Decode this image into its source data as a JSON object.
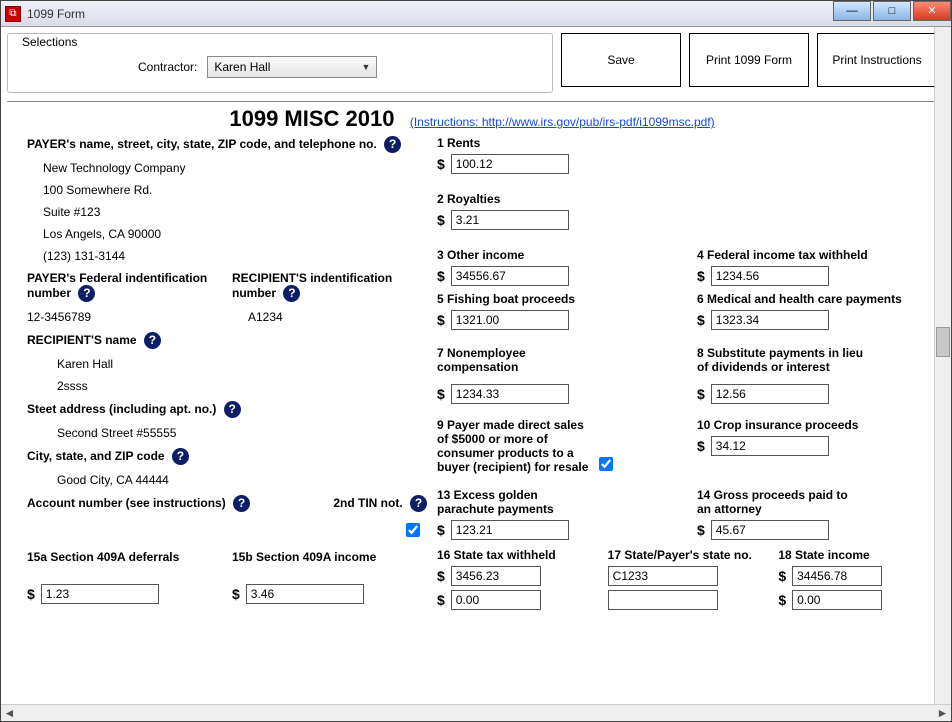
{
  "window": {
    "title": "1099 Form",
    "faded": "  "
  },
  "selections": {
    "legend": "Selections",
    "contractor_label": "Contractor:",
    "contractor_value": "Karen Hall"
  },
  "buttons": {
    "save": "Save",
    "print_form": "Print 1099 Form",
    "print_instr": "Print Instructions"
  },
  "form": {
    "title": "1099 MISC 2010",
    "instructions_link": "(Instructions: http://www.irs.gov/pub/irs-pdf/i1099msc.pdf)"
  },
  "payer": {
    "heading": "PAYER's name, street, city, state, ZIP code, and telephone no.",
    "name": "New Technology Company",
    "addr1": "100 Somewhere Rd.",
    "addr2": "Suite #123",
    "citystate": "Los Angels, CA 90000",
    "phone": "(123) 131-3144"
  },
  "payer_fed": {
    "label": "PAYER's Federal indentification number",
    "value": "12-3456789"
  },
  "recip_id": {
    "label": "RECIPIENT'S indentification number",
    "value": "A1234"
  },
  "recip": {
    "label": "RECIPIENT'S name",
    "name1": "Karen Hall",
    "name2": "2ssss"
  },
  "street": {
    "label": "Steet address (including apt. no.)",
    "value": "Second Street #55555"
  },
  "city": {
    "label": "City, state, and ZIP code",
    "value": "Good City, CA 44444"
  },
  "account": {
    "label": "Account number (see instructions)",
    "tin_label": "2nd TIN not."
  },
  "box15a": {
    "label": "15a Section 409A deferrals",
    "value": "1.23"
  },
  "box15b": {
    "label": "15b Section 409A income",
    "value": "3.46"
  },
  "boxes": {
    "1": {
      "label": "1   Rents",
      "value": "100.12"
    },
    "2": {
      "label": "2   Royalties",
      "value": "3.21"
    },
    "3": {
      "label": "3   Other income",
      "value": "34556.67"
    },
    "4": {
      "label": "4   Federal income tax withheld",
      "value": "1234.56"
    },
    "5": {
      "label": "5   Fishing boat proceeds",
      "value": "1321.00"
    },
    "6": {
      "label": "6   Medical and health care payments",
      "value": "1323.34"
    },
    "7": {
      "label": "7   Nonemployee compensation",
      "value": "1234.33"
    },
    "8": {
      "label": "8   Substitute payments in lieu of dividends or interest",
      "value": "12.56"
    },
    "9": {
      "label": "9  Payer made direct sales of $5000 or more of consumer products to a buyer (recipient) for resale"
    },
    "10": {
      "label": "10   Crop insurance proceeds",
      "value": "34.12"
    },
    "13": {
      "label": "13   Excess golden parachute payments",
      "value": "123.21"
    },
    "14": {
      "label": "14   Gross proceeds paid to an attorney",
      "value": "45.67"
    },
    "16": {
      "label": "16   State tax withheld",
      "v1": "3456.23",
      "v2": "0.00"
    },
    "17": {
      "label": "17   State/Payer's state no.",
      "v1": "C1233",
      "v2": ""
    },
    "18": {
      "label": "18   State income",
      "v1": "34456.78",
      "v2": "0.00"
    }
  }
}
